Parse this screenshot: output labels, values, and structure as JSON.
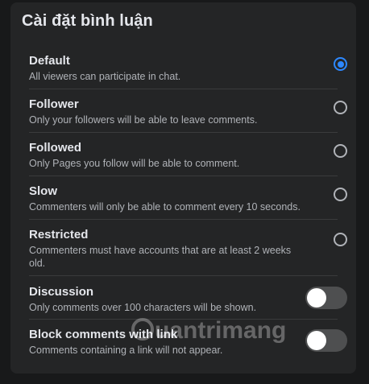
{
  "panel": {
    "title": "Cài đặt bình luận"
  },
  "options": [
    {
      "title": "Default",
      "description": "All viewers can participate in chat.",
      "control": "radio",
      "checked": true
    },
    {
      "title": "Follower",
      "description": "Only your followers will be able to leave comments.",
      "control": "radio",
      "checked": false
    },
    {
      "title": "Followed",
      "description": "Only Pages you follow will be able to comment.",
      "control": "radio",
      "checked": false
    },
    {
      "title": "Slow",
      "description": "Commenters will only be able to comment every 10 seconds.",
      "control": "radio",
      "checked": false
    },
    {
      "title": "Restricted",
      "description": "Commenters must have accounts that are at least 2 weeks old.",
      "control": "radio",
      "checked": false
    },
    {
      "title": "Discussion",
      "description": "Only comments over 100 characters will be shown.",
      "control": "toggle",
      "on": false
    },
    {
      "title": "Block comments with link",
      "description": "Comments containing a link will not appear.",
      "control": "toggle",
      "on": false
    }
  ],
  "watermark": {
    "text": "uantrimang"
  },
  "colors": {
    "accent": "#2d88ff",
    "panel_bg": "#242526",
    "page_bg": "#18191a"
  }
}
